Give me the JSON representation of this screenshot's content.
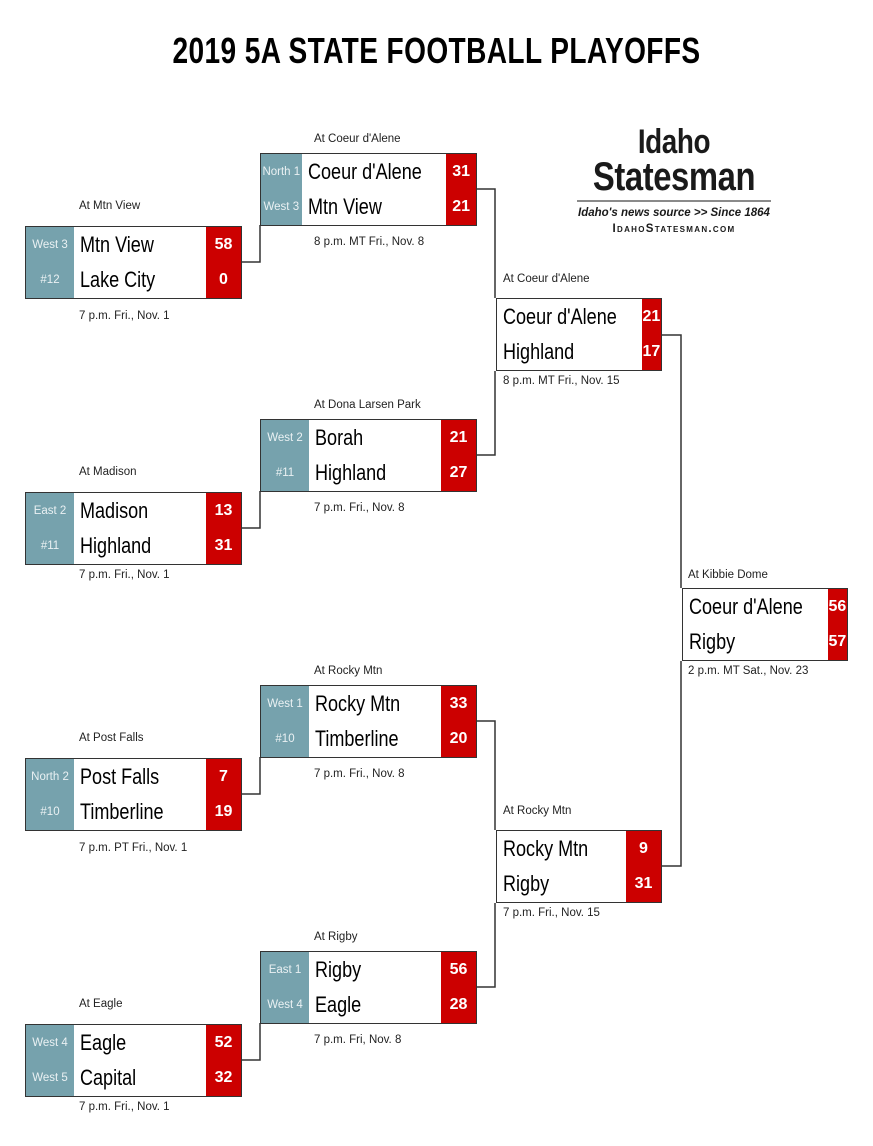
{
  "title": "2019 5A STATE FOOTBALL PLAYOFFS",
  "logo": {
    "line1": "Idaho",
    "line2": "Statesman",
    "tagline": "Idaho's news source >> Since 1864",
    "url": "IdahoStatesman.com"
  },
  "games": [
    {
      "id": "r1-g1",
      "venue": "At Mtn View",
      "time": "7 p.m. Fri., Nov. 1",
      "teams": [
        {
          "seed": "West 3",
          "name": "Mtn View",
          "score": "58"
        },
        {
          "seed": "#12",
          "name": "Lake City",
          "score": "0"
        }
      ]
    },
    {
      "id": "r1-g2",
      "venue": "At Madison",
      "time": "7 p.m. Fri., Nov. 1",
      "teams": [
        {
          "seed": "East 2",
          "name": "Madison",
          "score": "13"
        },
        {
          "seed": "#11",
          "name": "Highland",
          "score": "31"
        }
      ]
    },
    {
      "id": "r1-g3",
      "venue": "At Post Falls",
      "time": "7 p.m. PT Fri., Nov. 1",
      "teams": [
        {
          "seed": "North 2",
          "name": "Post Falls",
          "score": "7"
        },
        {
          "seed": "#10",
          "name": "Timberline",
          "score": "19"
        }
      ]
    },
    {
      "id": "r1-g4",
      "venue": "At Eagle",
      "time": "7 p.m. Fri., Nov. 1",
      "teams": [
        {
          "seed": "West 4",
          "name": "Eagle",
          "score": "52"
        },
        {
          "seed": "West 5",
          "name": "Capital",
          "score": "32"
        }
      ]
    },
    {
      "id": "qf-g1",
      "venue": "At Coeur d'Alene",
      "time": "8 p.m. MT Fri., Nov. 8",
      "teams": [
        {
          "seed": "North 1",
          "name": "Coeur d'Alene",
          "score": "31"
        },
        {
          "seed": "West 3",
          "name": "Mtn View",
          "score": "21"
        }
      ]
    },
    {
      "id": "qf-g2",
      "venue": "At Dona Larsen Park",
      "time": "7 p.m. Fri., Nov. 8",
      "teams": [
        {
          "seed": "West 2",
          "name": "Borah",
          "score": "21"
        },
        {
          "seed": "#11",
          "name": "Highland",
          "score": "27"
        }
      ]
    },
    {
      "id": "qf-g3",
      "venue": "At Rocky Mtn",
      "time": "7 p.m. Fri., Nov. 8",
      "teams": [
        {
          "seed": "West 1",
          "name": "Rocky Mtn",
          "score": "33"
        },
        {
          "seed": "#10",
          "name": "Timberline",
          "score": "20"
        }
      ]
    },
    {
      "id": "qf-g4",
      "venue": "At Rigby",
      "time": "7 p.m. Fri, Nov. 8",
      "teams": [
        {
          "seed": "East 1",
          "name": "Rigby",
          "score": "56"
        },
        {
          "seed": "West 4",
          "name": "Eagle",
          "score": "28"
        }
      ]
    },
    {
      "id": "sf-g1",
      "venue": "At Coeur d'Alene",
      "time": "8 p.m. MT Fri., Nov. 15",
      "teams": [
        {
          "name": "Coeur d'Alene",
          "score": "21"
        },
        {
          "name": "Highland",
          "score": "17"
        }
      ]
    },
    {
      "id": "sf-g2",
      "venue": "At Rocky Mtn",
      "time": "7 p.m. Fri., Nov. 15",
      "teams": [
        {
          "name": "Rocky Mtn",
          "score": "9"
        },
        {
          "name": "Rigby",
          "score": "31"
        }
      ]
    },
    {
      "id": "final",
      "venue": "At Kibbie Dome",
      "time": "2 p.m. MT Sat., Nov. 23",
      "teams": [
        {
          "name": "Coeur d'Alene",
          "score": "56"
        },
        {
          "name": "Rigby",
          "score": "57"
        }
      ]
    }
  ]
}
